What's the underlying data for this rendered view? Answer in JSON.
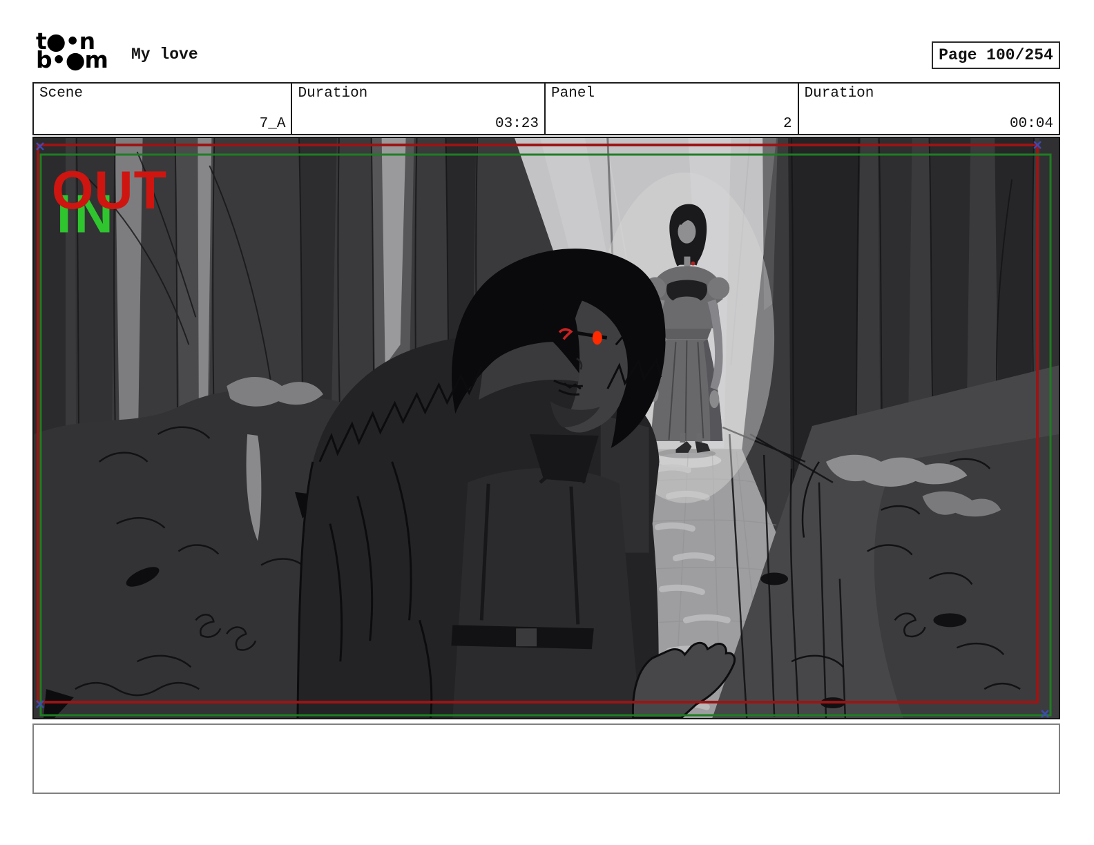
{
  "header": {
    "logo_line1": "t●•n",
    "logo_line2": "b•●m",
    "title": "My love",
    "page_label": "Page 100/254"
  },
  "metadata": {
    "cells": [
      {
        "label": "Scene",
        "value": "7_A"
      },
      {
        "label": "Duration",
        "value": "03:23"
      },
      {
        "label": "Panel",
        "value": "2"
      },
      {
        "label": "Duration",
        "value": "00:04"
      }
    ]
  },
  "panel": {
    "out_label": "OUT",
    "in_label": "IN",
    "colors": {
      "out_label": "#cf1510",
      "in_label": "#2ec52e",
      "out_frame": "#9c1414",
      "in_frame": "#1e7e22",
      "corner_marker": "#3c4cc0",
      "glow_eye": "#ff2a00"
    }
  },
  "caption": {
    "text": ""
  }
}
